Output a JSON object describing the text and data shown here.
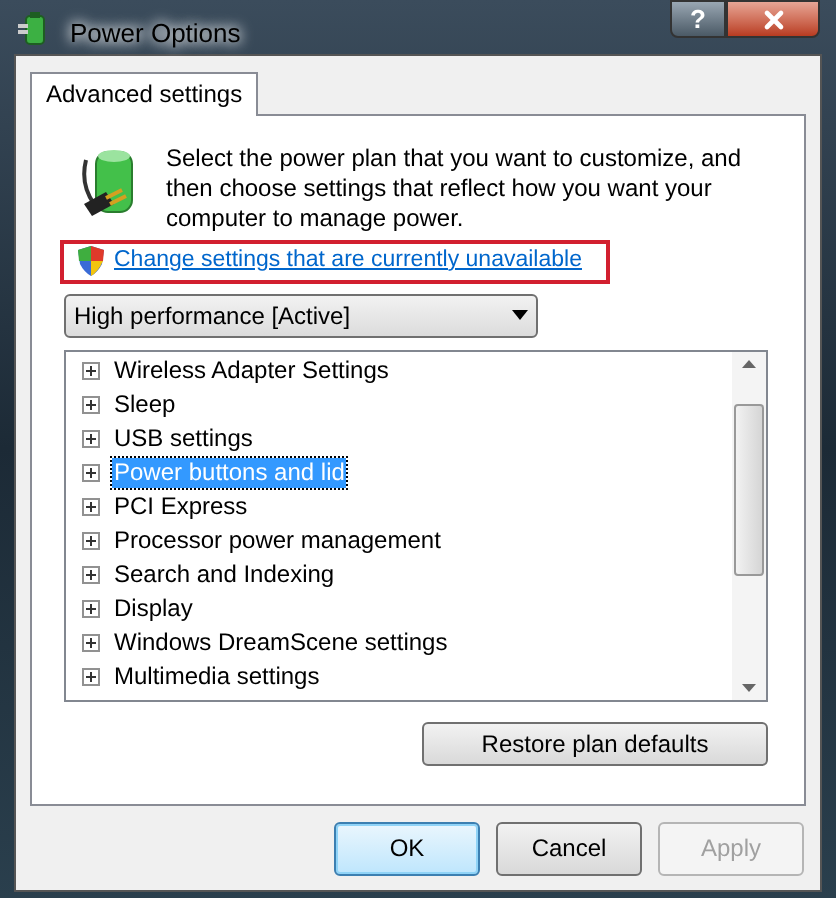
{
  "window": {
    "title": "Power Options",
    "help_button": "?"
  },
  "tabs": [
    {
      "label": "Advanced settings",
      "selected": true
    }
  ],
  "intro": "Select the power plan that you want to customize, and then choose settings that reflect how you want your computer to manage power.",
  "link": {
    "label": "Change settings that are currently unavailable",
    "highlighted": true
  },
  "plan_dropdown": {
    "value": "High performance [Active]"
  },
  "settings_tree": [
    {
      "label": "Wireless Adapter Settings",
      "selected": false,
      "expanded": false
    },
    {
      "label": "Sleep",
      "selected": false,
      "expanded": false
    },
    {
      "label": "USB settings",
      "selected": false,
      "expanded": false
    },
    {
      "label": "Power buttons and lid",
      "selected": true,
      "expanded": false
    },
    {
      "label": "PCI Express",
      "selected": false,
      "expanded": false
    },
    {
      "label": "Processor power management",
      "selected": false,
      "expanded": false
    },
    {
      "label": "Search and Indexing",
      "selected": false,
      "expanded": false
    },
    {
      "label": "Display",
      "selected": false,
      "expanded": false
    },
    {
      "label": "Windows DreamScene settings",
      "selected": false,
      "expanded": false
    },
    {
      "label": "Multimedia settings",
      "selected": false,
      "expanded": false
    }
  ],
  "restore_button": {
    "label": "Restore plan defaults",
    "disabled": false
  },
  "buttons": [
    {
      "label": "OK",
      "disabled": false,
      "default": true
    },
    {
      "label": "Cancel",
      "disabled": false,
      "default": false
    },
    {
      "label": "Apply",
      "disabled": true,
      "default": false
    }
  ]
}
